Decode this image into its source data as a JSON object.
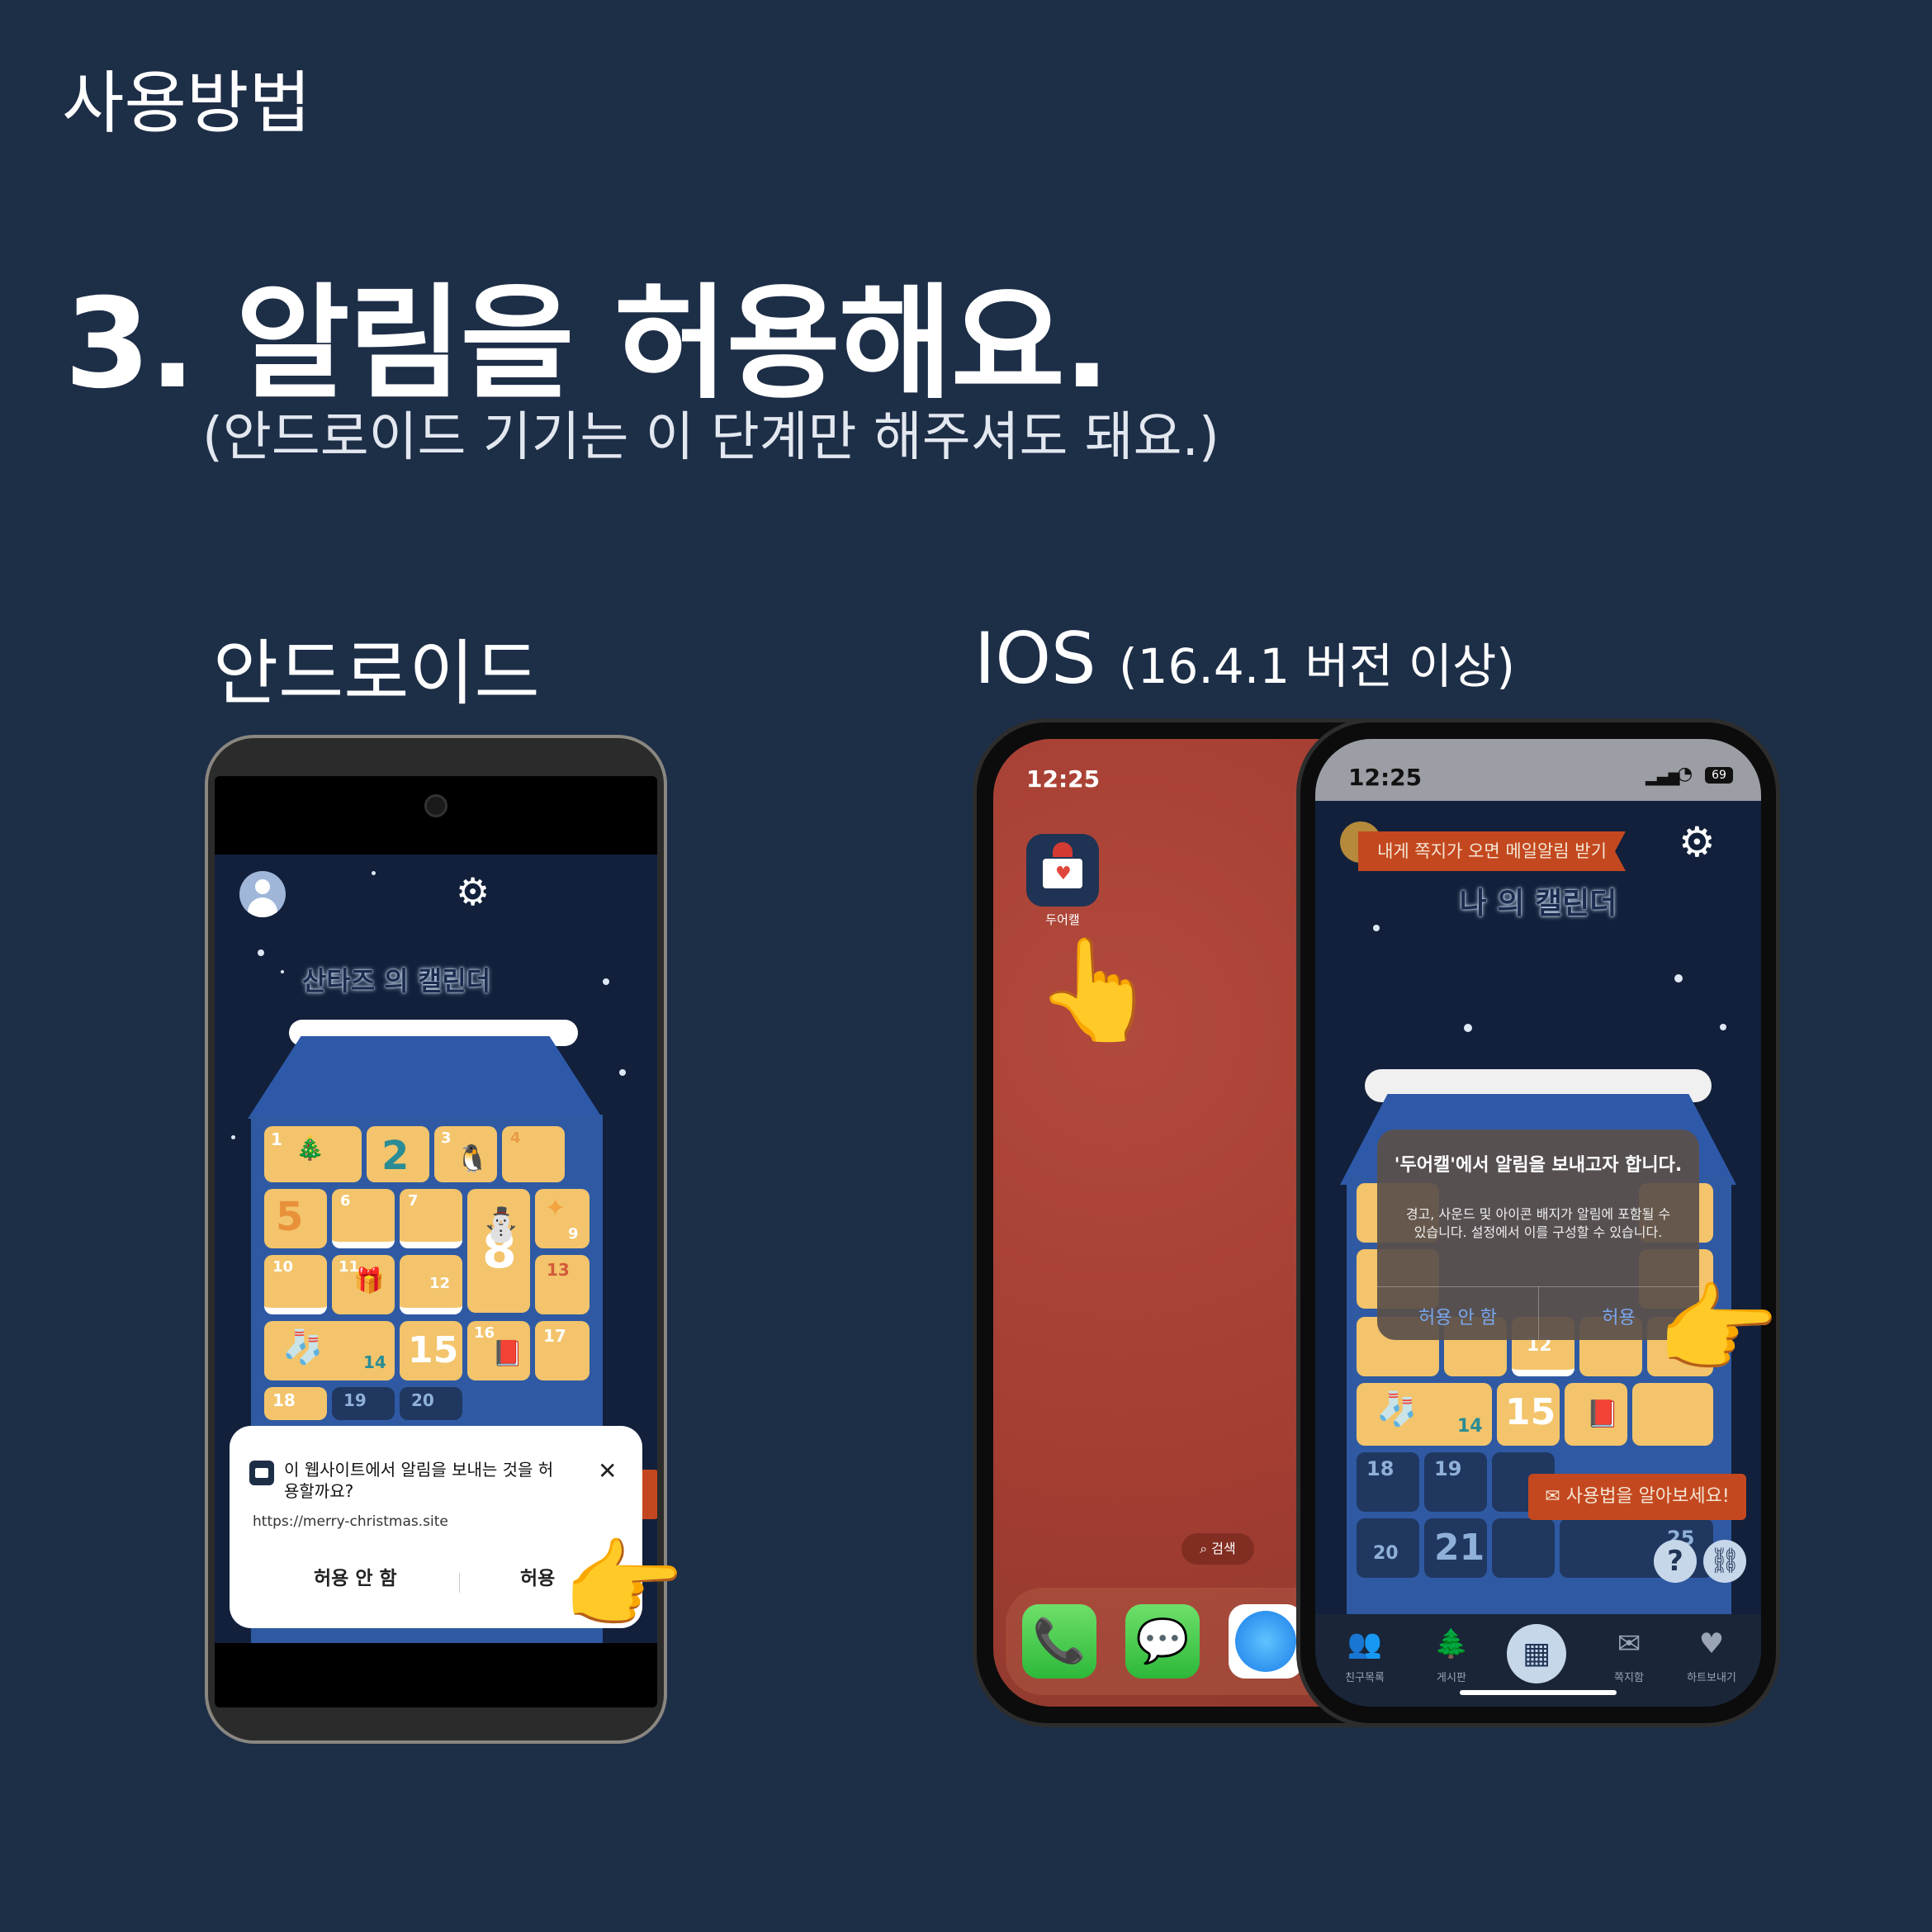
{
  "page": {
    "section_label": "사용방법",
    "step_title": "3. 알림을 허용해요.",
    "step_subtitle": "(안드로이드 기기는 이 단계만 해주셔도 돼요.)",
    "android_heading": "안드로이드",
    "ios_heading": "IOS",
    "ios_heading_note": "(16.4.1 버전 이상)"
  },
  "android": {
    "calendar_title": "산타즈 의 캘린더",
    "calendar_numbers": [
      "1",
      "2",
      "3",
      "4",
      "5",
      "6",
      "7",
      "8",
      "9",
      "10",
      "11",
      "12",
      "13",
      "14",
      "15",
      "16",
      "17",
      "18",
      "19",
      "20"
    ],
    "dialog": {
      "message": "이 웹사이트에서 알림을 보내는 것을 허용할까요?",
      "url": "https://merry-christmas.site",
      "deny_label": "허용 안 함",
      "allow_label": "허용",
      "close_glyph": "✕"
    }
  },
  "ios_home": {
    "time": "12:25",
    "app_label": "두어캘",
    "search_label": "검색"
  },
  "ios_app": {
    "time": "12:25",
    "battery": "69",
    "mail_alert_banner": "내게 쪽지가 오면 메일알림 받기",
    "calendar_title": "나 의 캘린더",
    "calendar_numbers": [
      "12",
      "14",
      "15",
      "18",
      "19",
      "20",
      "21",
      "25"
    ],
    "help_banner": "사용법을 알아보세요!",
    "dialog": {
      "title": "'두어캘'에서 알림을 보내고자 합니다.",
      "message": "경고, 사운드 및 아이콘 배지가 알림에 포함될 수 있습니다. 설정에서 이를 구성할 수 있습니다.",
      "deny_label": "허용 안 함",
      "allow_label": "허용"
    },
    "tabs": [
      {
        "label": "친구목록",
        "icon": "friends-icon"
      },
      {
        "label": "게시판",
        "icon": "tree-icon"
      },
      {
        "label": "",
        "icon": "calendar-icon"
      },
      {
        "label": "쪽지함",
        "icon": "mail-icon"
      },
      {
        "label": "하트보내기",
        "icon": "heart-icon"
      }
    ]
  },
  "colors": {
    "background": "#1d2e47",
    "app_navy": "#12203b",
    "calendar_cell": "#f3c46b",
    "house_blue": "#2f5aa3",
    "banner_orange": "#c4481f",
    "ios_allow_blue": "#7aa7ee"
  }
}
